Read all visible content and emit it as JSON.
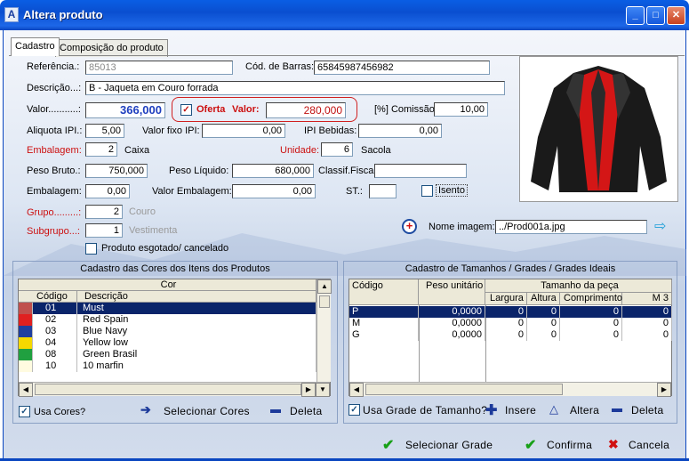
{
  "window": {
    "title": "Altera produto",
    "min": "_",
    "max": "□",
    "close": "✕"
  },
  "tabs": [
    {
      "label": "Cadastro"
    },
    {
      "label": "Composição do produto"
    }
  ],
  "form": {
    "referencia_label": "Referência.:",
    "referencia_value": "85013",
    "cod_barras_label": "Cód. de Barras:",
    "cod_barras_value": "65845987456982",
    "descricao_label": "Descrição...:",
    "descricao_value": "B - Jaqueta em Couro forrada",
    "valor_label": "Valor...........:",
    "valor_value": "366,000",
    "oferta_label": "Oferta",
    "oferta_valor_label": "Valor:",
    "oferta_valor_value": "280,000",
    "comissao_label": "[%] Comissão:",
    "comissao_value": "10,00",
    "aliquota_ipi_label": "Aliquota IPI.:",
    "aliquota_ipi_value": "5,00",
    "valor_fixo_ipi_label": "Valor fixo IPI:",
    "valor_fixo_ipi_value": "0,00",
    "ipi_bebidas_label": "IPI Bebidas:",
    "ipi_bebidas_value": "0,00",
    "embalagem_label": "Embalagem:",
    "embalagem_value": "2",
    "embalagem_unit": "Caixa",
    "unidade_label": "Unidade:",
    "unidade_value": "6",
    "unidade_unit": "Sacola",
    "peso_bruto_label": "Peso Bruto.:",
    "peso_bruto_value": "750,000",
    "peso_liquido_label": "Peso Líquido:",
    "peso_liquido_value": "680,000",
    "classif_fiscal_label": "Classif.Fiscal:",
    "classif_fiscal_value": "",
    "embalagem2_label": "Embalagem:",
    "embalagem2_value": "0,00",
    "valor_embalagem_label": "Valor Embalagem:",
    "valor_embalagem_value": "0,00",
    "st_label": "ST.:",
    "st_value": "",
    "isento_label": "Isento",
    "grupo_label": "Grupo.........:",
    "grupo_value": "2",
    "grupo_name": "Couro",
    "subgrupo_label": "Subgrupo...:",
    "subgrupo_value": "1",
    "subgrupo_name": "Vestimenta",
    "esgotado_label": "Produto esgotado/ cancelado",
    "nome_imagem_label": "Nome imagem:",
    "nome_imagem_value": "../Prod001a.jpg"
  },
  "cores": {
    "title": "Cadastro das Cores dos Itens dos Produtos",
    "group_header": "Cor",
    "col_codigo": "Código",
    "col_descricao": "Descrição",
    "rows": [
      {
        "codigo": "01",
        "descricao": "Must",
        "color": "#c0504d"
      },
      {
        "codigo": "02",
        "descricao": "Red Spain",
        "color": "#e02020"
      },
      {
        "codigo": "03",
        "descricao": "Blue Navy",
        "color": "#1f3f9f"
      },
      {
        "codigo": "04",
        "descricao": "Yellow low",
        "color": "#f5d800"
      },
      {
        "codigo": "08",
        "descricao": "Green Brasil",
        "color": "#20a040"
      },
      {
        "codigo": "10",
        "descricao": "10 marfin",
        "color": "#fffbe0"
      }
    ],
    "usa_cores_label": "Usa Cores?",
    "selecionar_label": "Selecionar Cores",
    "deleta_label": "Deleta"
  },
  "tamanhos": {
    "title": "Cadastro de Tamanhos / Grades / Grades Ideais",
    "col_codigo": "Código",
    "col_peso": "Peso unitário",
    "group_header": "Tamanho da peça",
    "col_largura": "Largura",
    "col_altura": "Altura",
    "col_comprimento": "Comprimento",
    "col_m3": "M 3",
    "rows": [
      {
        "codigo": "P",
        "peso": "0,0000",
        "largura": "0",
        "altura": "0",
        "comprimento": "0",
        "m3": "0"
      },
      {
        "codigo": "M",
        "peso": "0,0000",
        "largura": "0",
        "altura": "0",
        "comprimento": "0",
        "m3": "0"
      },
      {
        "codigo": "G",
        "peso": "0,0000",
        "largura": "0",
        "altura": "0",
        "comprimento": "0",
        "m3": "0"
      }
    ],
    "usa_grade_label": "Usa Grade de Tamanho?",
    "insere_label": "Insere",
    "altera_label": "Altera",
    "deleta_label": "Deleta"
  },
  "footer": {
    "selecionar_grade": "Selecionar Grade",
    "confirma": "Confirma",
    "cancela": "Cancela"
  },
  "colors": {
    "accent_blue": "#0a246a",
    "red_label": "#cc1010",
    "title_bar": "#0a5ee4"
  }
}
